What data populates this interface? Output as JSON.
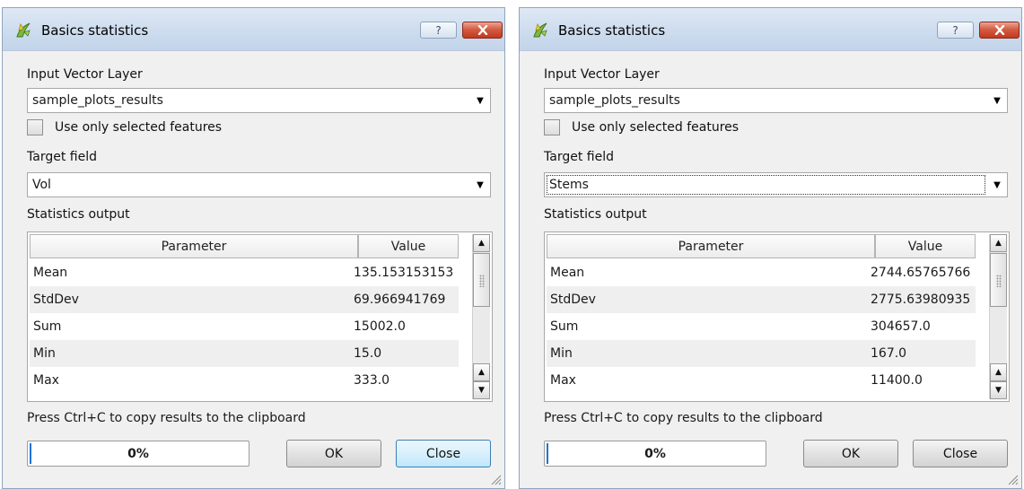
{
  "dialogs": [
    {
      "title": "Basics statistics",
      "help_label": "?",
      "close_label": "✕",
      "input_layer_label": "Input Vector Layer",
      "input_layer_value": "sample_plots_results",
      "use_selected_label": "Use only selected features",
      "use_selected_checked": false,
      "target_field_label": "Target field",
      "target_field_value": "Vol",
      "stats_label": "Statistics output",
      "table": {
        "headers": [
          "Parameter",
          "Value"
        ],
        "rows": [
          {
            "param": "Mean",
            "value": "135.153153153"
          },
          {
            "param": "StdDev",
            "value": "69.966941769"
          },
          {
            "param": "Sum",
            "value": "15002.0"
          },
          {
            "param": "Min",
            "value": "15.0"
          },
          {
            "param": "Max",
            "value": "333.0"
          }
        ]
      },
      "clipboard_note": "Press Ctrl+C to copy results to the clipboard",
      "progress_text": "0%",
      "progress_value": 0.0,
      "ok_label": "OK",
      "close_button_label": "Close"
    },
    {
      "title": "Basics statistics",
      "help_label": "?",
      "close_label": "✕",
      "input_layer_label": "Input Vector Layer",
      "input_layer_value": "sample_plots_results",
      "use_selected_label": "Use only selected features",
      "use_selected_checked": false,
      "target_field_label": "Target field",
      "target_field_value": "Stems",
      "stats_label": "Statistics output",
      "table": {
        "headers": [
          "Parameter",
          "Value"
        ],
        "rows": [
          {
            "param": "Mean",
            "value": "2744.65765766"
          },
          {
            "param": "StdDev",
            "value": "2775.63980935"
          },
          {
            "param": "Sum",
            "value": "304657.0"
          },
          {
            "param": "Min",
            "value": "167.0"
          },
          {
            "param": "Max",
            "value": "11400.0"
          }
        ]
      },
      "clipboard_note": "Press Ctrl+C to copy results to the clipboard",
      "progress_text": "0%",
      "progress_value": 0.0,
      "ok_label": "OK",
      "close_button_label": "Close"
    }
  ],
  "colors": {
    "titlebar": "#cddcee",
    "dialog_bg": "#f0f0f0",
    "close_red": "#c1391e",
    "progress_blue": "#1e73d6",
    "row_alt": "#efefef"
  },
  "icons": {
    "app": "qgis-icon",
    "help": "help-icon",
    "close": "close-icon",
    "dropdown": "chevron-down-icon",
    "scroll_up": "arrow-up-icon",
    "scroll_down": "arrow-down-icon",
    "resize": "resize-grip-icon"
  }
}
